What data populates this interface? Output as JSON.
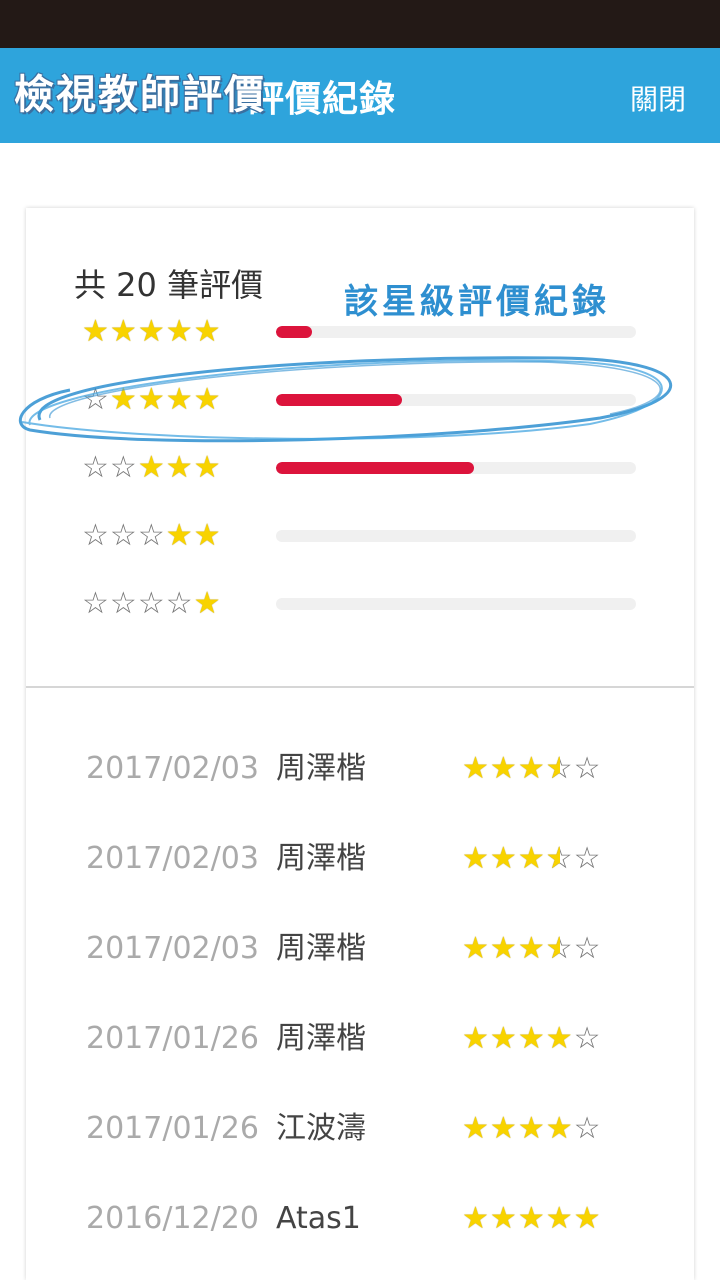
{
  "header": {
    "title": "評價紀錄",
    "annotation": "檢視教師評價",
    "close_label": "關閉",
    "background_color": "#2ea4dc"
  },
  "summary": {
    "title": "共 20 筆評價",
    "annotation": "該星級評價紀錄",
    "distribution": [
      {
        "stars": 5,
        "fraction": 0.1
      },
      {
        "stars": 4,
        "fraction": 0.35
      },
      {
        "stars": 3,
        "fraction": 0.55
      },
      {
        "stars": 2,
        "fraction": 0.0
      },
      {
        "stars": 1,
        "fraction": 0.0
      }
    ],
    "bar_color": "#dc143c"
  },
  "reviews": [
    {
      "date": "2017/02/03",
      "name": "周澤楷",
      "rating": 3.5
    },
    {
      "date": "2017/02/03",
      "name": "周澤楷",
      "rating": 3.5
    },
    {
      "date": "2017/02/03",
      "name": "周澤楷",
      "rating": 3.5
    },
    {
      "date": "2017/01/26",
      "name": "周澤楷",
      "rating": 4
    },
    {
      "date": "2017/01/26",
      "name": "江波濤",
      "rating": 4
    },
    {
      "date": "2016/12/20",
      "name": "Atas1",
      "rating": 5
    }
  ],
  "icons": {
    "star_full": "star-filled-icon",
    "star_empty": "star-outline-icon",
    "star_half": "star-half-icon"
  },
  "colors": {
    "star": "#f8d300",
    "annotation_ink": "#2e8fd0"
  }
}
